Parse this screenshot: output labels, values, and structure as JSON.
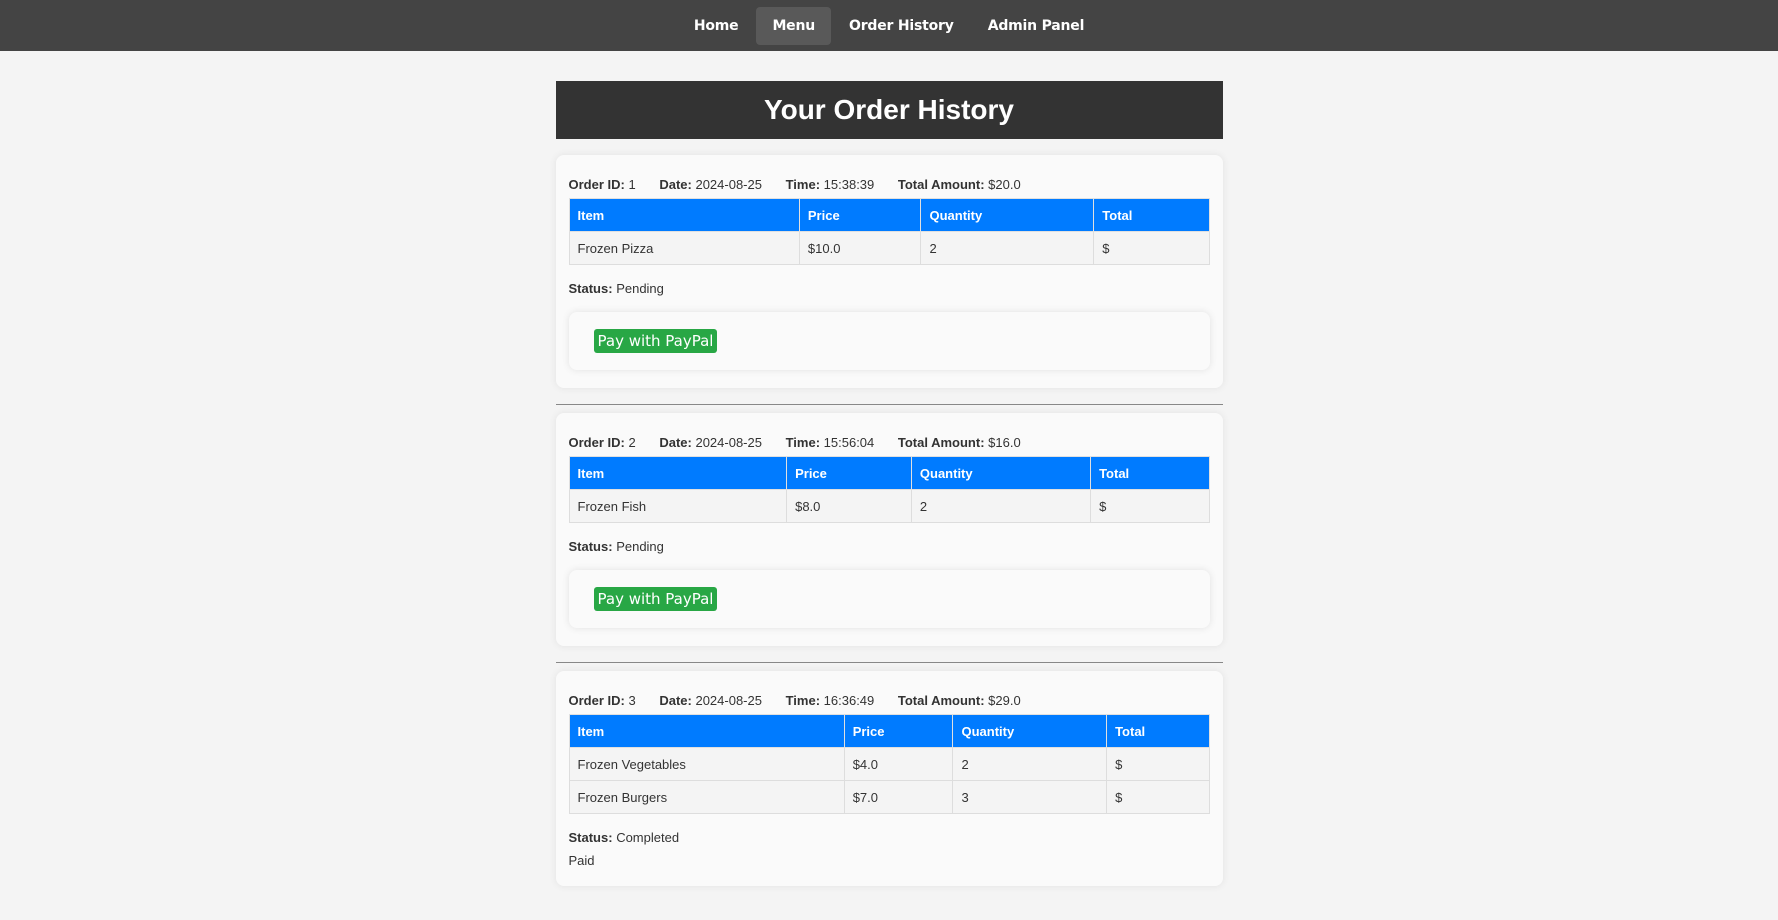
{
  "nav": {
    "items": [
      {
        "label": "Home",
        "active": false
      },
      {
        "label": "Menu",
        "active": true
      },
      {
        "label": "Order History",
        "active": false
      },
      {
        "label": "Admin Panel",
        "active": false
      }
    ]
  },
  "page": {
    "title": "Your Order History"
  },
  "labels": {
    "order_id": "Order ID:",
    "date": "Date:",
    "time": "Time:",
    "total_amount": "Total Amount:",
    "status": "Status:",
    "paypal_button": "Pay with PayPal"
  },
  "table_headers": [
    "Item",
    "Price",
    "Quantity",
    "Total"
  ],
  "orders": [
    {
      "id": "1",
      "date": "2024-08-25",
      "time": "15:38:39",
      "total": "$20.0",
      "items": [
        {
          "item": "Frozen Pizza",
          "price": "$10.0",
          "quantity": "2",
          "total": "$"
        }
      ],
      "status": "Pending",
      "show_paypal": true
    },
    {
      "id": "2",
      "date": "2024-08-25",
      "time": "15:56:04",
      "total": "$16.0",
      "items": [
        {
          "item": "Frozen Fish",
          "price": "$8.0",
          "quantity": "2",
          "total": "$"
        }
      ],
      "status": "Pending",
      "show_paypal": true
    },
    {
      "id": "3",
      "date": "2024-08-25",
      "time": "16:36:49",
      "total": "$29.0",
      "items": [
        {
          "item": "Frozen Vegetables",
          "price": "$4.0",
          "quantity": "2",
          "total": "$"
        },
        {
          "item": "Frozen Burgers",
          "price": "$7.0",
          "quantity": "3",
          "total": "$"
        }
      ],
      "status": "Completed",
      "paid_text": "Paid",
      "show_paypal": false
    }
  ]
}
